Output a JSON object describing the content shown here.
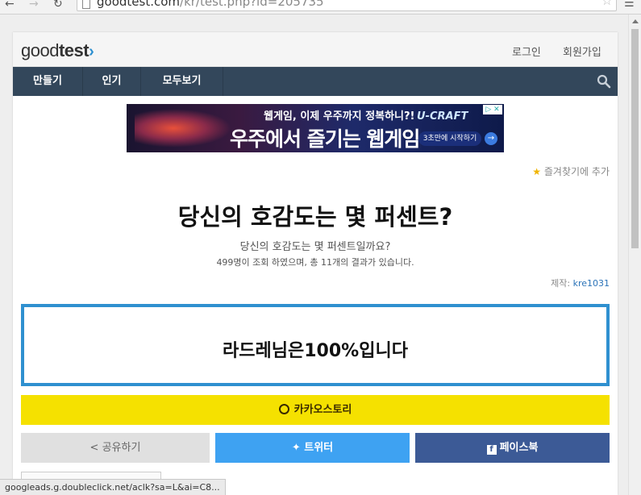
{
  "browser": {
    "url_domain": "goodtest.com",
    "url_path": "/kr/test.php?id=205735",
    "status_url": "googleads.g.doubleclick.net/aclk?sa=L&ai=C8..."
  },
  "header": {
    "logo_light": "good",
    "logo_bold": "test",
    "login": "로그인",
    "signup": "회원가입"
  },
  "menu": {
    "items": [
      "만들기",
      "인기",
      "모두보기"
    ]
  },
  "ad": {
    "line1": "웹게임, 이제 우주까지 정복하니?!",
    "line2": "우주에서 즐기는 웹게임",
    "brand": "U-CRAFT",
    "cta": "3초만에 시작하기"
  },
  "favorite": {
    "label": "즐겨찾기에 추가"
  },
  "test": {
    "title": "당신의 호감도는 몇 퍼센트?",
    "subtitle": "당신의 호감도는 몇 퍼센트일까요?",
    "stats": "499명이 조회 하였으며, 총 11개의 결과가 있습니다.",
    "maker_label": "제작:",
    "maker_name": "kre1031",
    "result": "라드레님은100%입니다"
  },
  "share": {
    "kakao": "카카오스토리",
    "generic": "공유하기",
    "twitter": "트위터",
    "facebook": "페이스북"
  },
  "colors": {
    "menubar": "#33475b",
    "result_border": "#2f90d0",
    "kakao": "#f5e100",
    "twitter": "#3ea2f2",
    "facebook": "#3c5a96"
  }
}
